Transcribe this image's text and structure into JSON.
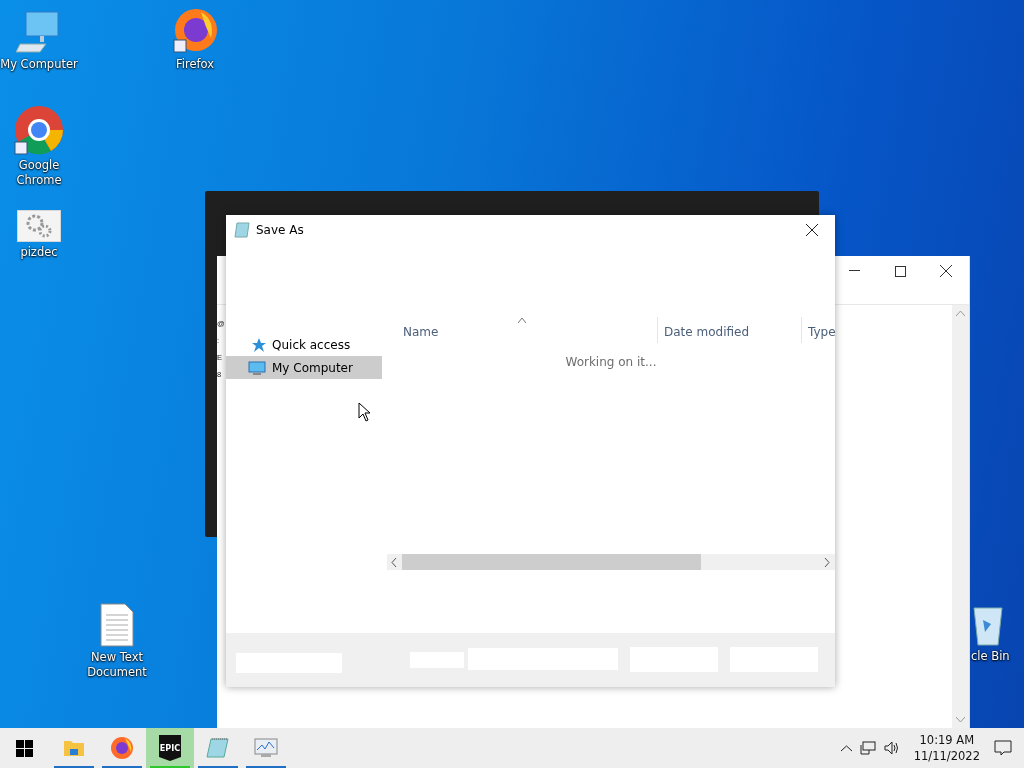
{
  "desktop_icons": [
    {
      "label": "My Computer",
      "kind": "computer"
    },
    {
      "label": "Firefox",
      "kind": "firefox"
    },
    {
      "label": "Google Chrome",
      "kind": "chrome"
    },
    {
      "label": "pizdec",
      "kind": "gears"
    },
    {
      "label": "New Text Document",
      "kind": "textfile"
    },
    {
      "label": "cle Bin",
      "kind": "recycle"
    }
  ],
  "back_window": {
    "text_fragments": [
      "@",
      ":",
      "E",
      "8"
    ]
  },
  "save_as_dialog": {
    "title": "Save As",
    "nav_items": [
      {
        "label": "Quick access",
        "kind": "star",
        "selected": false
      },
      {
        "label": "My Computer",
        "kind": "computer",
        "selected": true
      }
    ],
    "columns": [
      {
        "label": "Name",
        "sorted": true
      },
      {
        "label": "Date modified",
        "sorted": false
      },
      {
        "label": "Type",
        "sorted": false
      }
    ],
    "status": "Working on it..."
  },
  "taskbar": {
    "apps": [
      {
        "kind": "folder",
        "selected": false
      },
      {
        "kind": "firefox",
        "selected": false
      },
      {
        "kind": "epic",
        "label": "EPIC",
        "selected": true
      },
      {
        "kind": "notepad",
        "selected": false
      },
      {
        "kind": "monitor",
        "selected": false
      }
    ],
    "time": "10:19 AM",
    "date": "11/11/2022"
  }
}
